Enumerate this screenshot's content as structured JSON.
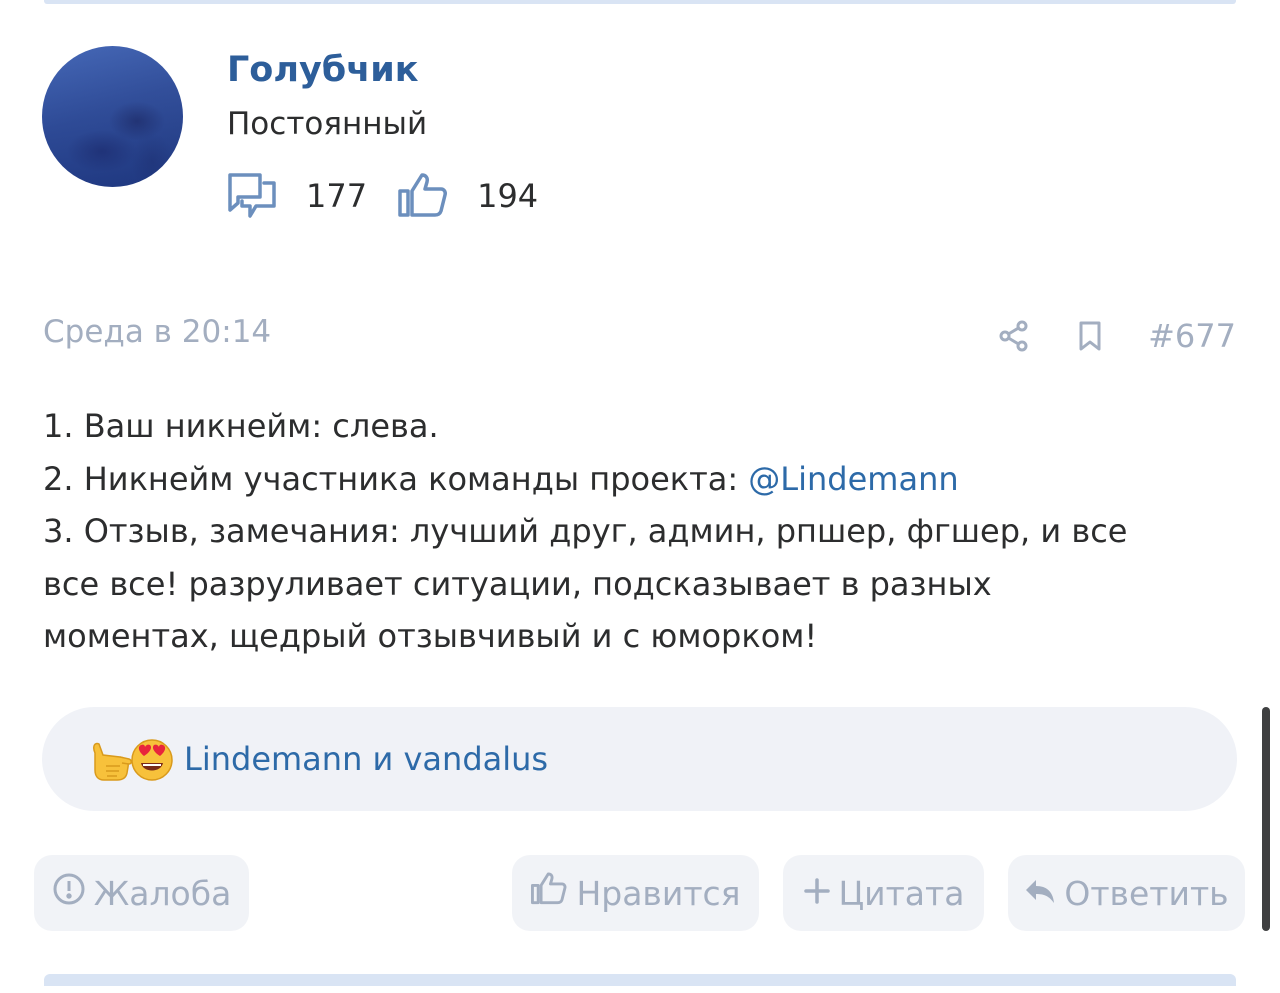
{
  "user": {
    "name": "Голубчик",
    "rank": "Постоянный",
    "messages_count": "177",
    "likes_count": "194"
  },
  "post": {
    "date": "Среда в 20:14",
    "number": "#677",
    "line1": "1. Ваш никнейм: слева.",
    "line2_prefix": "2. Никнейм участника команды проекта: ",
    "line2_mention": "@Lindemann",
    "line3": "3. Отзыв, замечания: лучший друг, админ, рпшер, фгшер, и все",
    "line4": "все все! разруливает ситуации, подсказывает в разных",
    "line5": "моментах, щедрый отзывчивый и с юморком!"
  },
  "reactions": {
    "text": "Lindemann и vandalus",
    "emojis": [
      "call-me-hand-emoji",
      "heart-eyes-emoji"
    ]
  },
  "buttons": {
    "report": "Жалоба",
    "like": "Нравится",
    "quote": "Цитата",
    "reply": "Ответить"
  },
  "colors": {
    "link": "#2d6aa8",
    "username": "#2d5e9a",
    "muted": "#a3aec0",
    "text": "#2c2d2e",
    "button_bg": "#f1f3f7"
  }
}
